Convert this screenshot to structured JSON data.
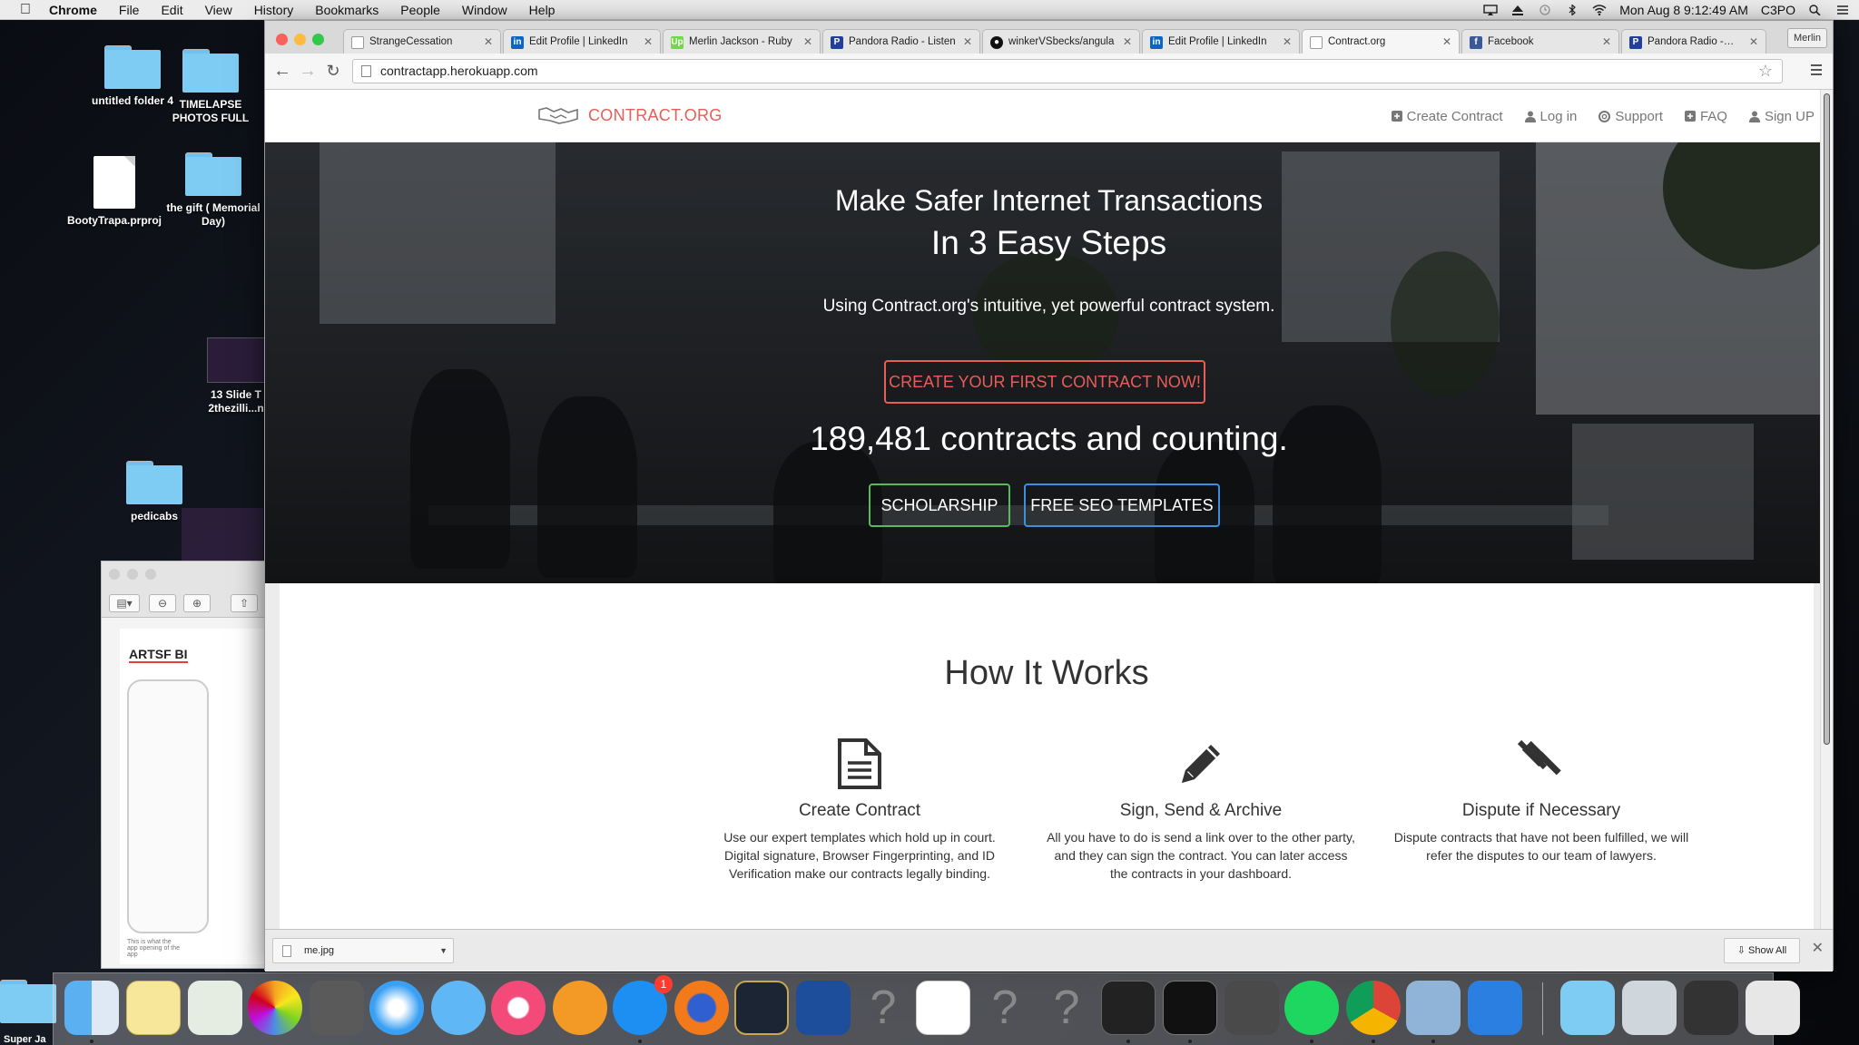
{
  "menubar": {
    "app": "Chrome",
    "items": [
      "File",
      "Edit",
      "View",
      "History",
      "Bookmarks",
      "People",
      "Window",
      "Help"
    ],
    "clock": "Mon Aug 8  9:12:49 AM",
    "user": "C3PO"
  },
  "desktop": {
    "icons": [
      {
        "label": "untitled folder 4",
        "kind": "folder"
      },
      {
        "label": "TIMELAPSE PHOTOS FULL",
        "kind": "folder"
      },
      {
        "label": "BootyTrapa.prproj",
        "kind": "document"
      },
      {
        "label": "the gift ( Memorial Day)",
        "kind": "folder"
      },
      {
        "label": "13 Slide T 2thezilli...n",
        "kind": "image"
      },
      {
        "label": "pedicabs",
        "kind": "folder"
      }
    ],
    "edge_label": "Super Ja"
  },
  "preview": {
    "doc_title": "ARTSF BI",
    "caption": "This is what the app opening of the app"
  },
  "browser": {
    "tabs": [
      {
        "title": "StrangeCessation",
        "favicon": "page-icon",
        "active": false
      },
      {
        "title": "Edit Profile | LinkedIn",
        "favicon": "linkedin-icon",
        "active": false
      },
      {
        "title": "Merlin Jackson - Ruby",
        "favicon": "upwork-icon",
        "active": false
      },
      {
        "title": "Pandora Radio - Listen",
        "favicon": "pandora-icon",
        "active": false
      },
      {
        "title": "winkerVSbecks/angula",
        "favicon": "github-icon",
        "active": false
      },
      {
        "title": "Edit Profile | LinkedIn",
        "favicon": "linkedin-icon",
        "active": false
      },
      {
        "title": "Contract.org",
        "favicon": "page-icon",
        "active": true
      },
      {
        "title": "Facebook",
        "favicon": "facebook-icon",
        "active": false
      },
      {
        "title": "Pandora Radio - Lis",
        "favicon": "pandora-icon",
        "active": false
      }
    ],
    "profile": "Merlin",
    "url": "contractapp.herokuapp.com",
    "download": {
      "filename": "me.jpg",
      "show_all": "Show All"
    }
  },
  "site": {
    "logo": {
      "brand": "CONTRACT",
      "tld": ".ORG"
    },
    "nav": [
      {
        "label": "Create Contract",
        "icon": "plus-square-icon"
      },
      {
        "label": "Log in",
        "icon": "user-icon"
      },
      {
        "label": "Support",
        "icon": "lifebuoy-icon"
      },
      {
        "label": "FAQ",
        "icon": "plus-square-icon"
      },
      {
        "label": "Sign UP",
        "icon": "user-icon"
      }
    ],
    "hero": {
      "headline_1": "Make Safer Internet Transactions",
      "headline_2": "In 3 Easy Steps",
      "subtitle": "Using Contract.org's intuitive, yet powerful contract system.",
      "cta": "CREATE YOUR FIRST CONTRACT NOW!",
      "counter": "189,481 contracts and counting.",
      "btn_scholarship": "SCHOLARSHIP",
      "btn_seo": "FREE SEO TEMPLATES"
    },
    "how": {
      "title": "How It Works",
      "features": [
        {
          "title": "Create Contract",
          "text": "Use our expert templates which hold up in court. Digital signature, Browser Fingerprinting, and ID Verification make our contracts legally binding.",
          "icon": "document-icon"
        },
        {
          "title": "Sign, Send & Archive",
          "text": "All you have to do is send a link over to the other party, and they can sign the contract. You can later access the contracts in your dashboard.",
          "icon": "pencil-icon"
        },
        {
          "title": "Dispute if Necessary",
          "text": "Dispute contracts that have not been fulfilled, we will refer the disputes to our team of lawyers.",
          "icon": "gavel-icon"
        }
      ]
    }
  },
  "dock": {
    "appstore_badge": "1"
  },
  "colors": {
    "brand_red": "#e85d57",
    "scholarship_green": "#5cb85c",
    "seo_blue": "#3f8fe0"
  }
}
